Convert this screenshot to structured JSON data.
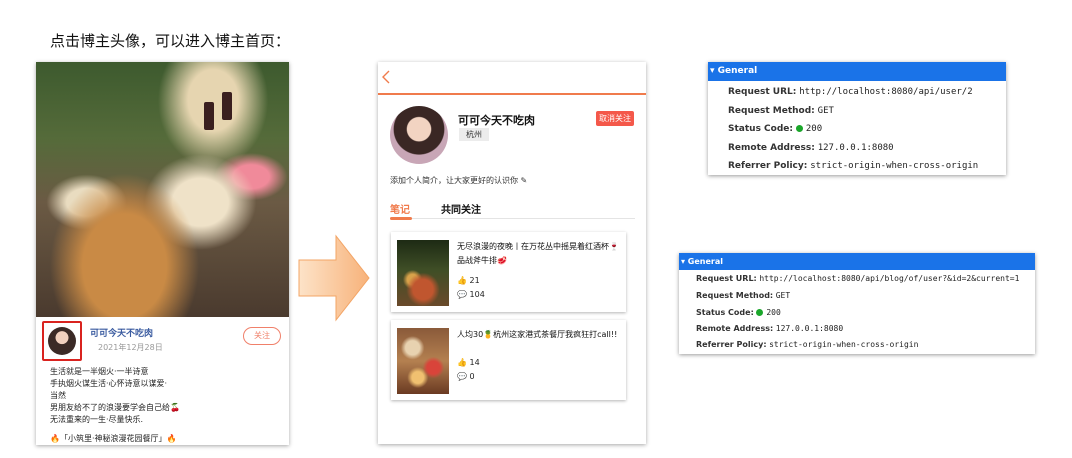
{
  "heading": "点击博主头像，可以进入博主首页：",
  "post": {
    "author": "可可今天不吃肉",
    "date": "2021年12月28日",
    "follow_label": "关注",
    "lines": [
      "生活就是一半烟火·一半诗意",
      "手执烟火谋生活·心怀诗意以谋爱·",
      "当然",
      "男朋友给不了的浪漫要学会自己给🍒",
      "无法重来的一生·尽量快乐."
    ],
    "last_line": "🔥「小筑里·神秘浪漫花园餐厅」🔥"
  },
  "home": {
    "name": "可可今天不吃肉",
    "city": "杭州",
    "unfollow_label": "取消关注",
    "intro": "添加个人简介，让大家更好的认识你 ✎",
    "tabs": [
      "笔记",
      "共同关注"
    ],
    "notes": [
      {
        "title": "无尽浪漫的夜晚丨在万花丛中摇晃着红酒杯🍷品战斧牛排🥩",
        "likes": "21",
        "comments": "104"
      },
      {
        "title": "人均30🍍杭州这家港式茶餐厅我疯狂打call!!",
        "likes": "14",
        "comments": "0"
      }
    ]
  },
  "panel1": {
    "header": "▾ General",
    "rows": [
      {
        "key": "Request URL:",
        "value": "http://localhost:8080/api/user/2"
      },
      {
        "key": "Request Method:",
        "value": "GET"
      },
      {
        "key": "Status Code:",
        "value": "200"
      },
      {
        "key": "Remote Address:",
        "value": "127.0.0.1:8080"
      },
      {
        "key": "Referrer Policy:",
        "value": "strict-origin-when-cross-origin"
      }
    ]
  },
  "panel2": {
    "header": "▾ General",
    "rows": [
      {
        "key": "Request URL:",
        "value": "http://localhost:8080/api/blog/of/user?&id=2&current=1"
      },
      {
        "key": "Request Method:",
        "value": "GET"
      },
      {
        "key": "Status Code:",
        "value": "200"
      },
      {
        "key": "Remote Address:",
        "value": "127.0.0.1:8080"
      },
      {
        "key": "Referrer Policy:",
        "value": "strict-origin-when-cross-origin"
      }
    ]
  },
  "colors": {
    "accent": "#f07b4c",
    "highlight": "#d9231f",
    "devtools_blue": "#1a73e8",
    "status_green": "#1aa62a"
  }
}
